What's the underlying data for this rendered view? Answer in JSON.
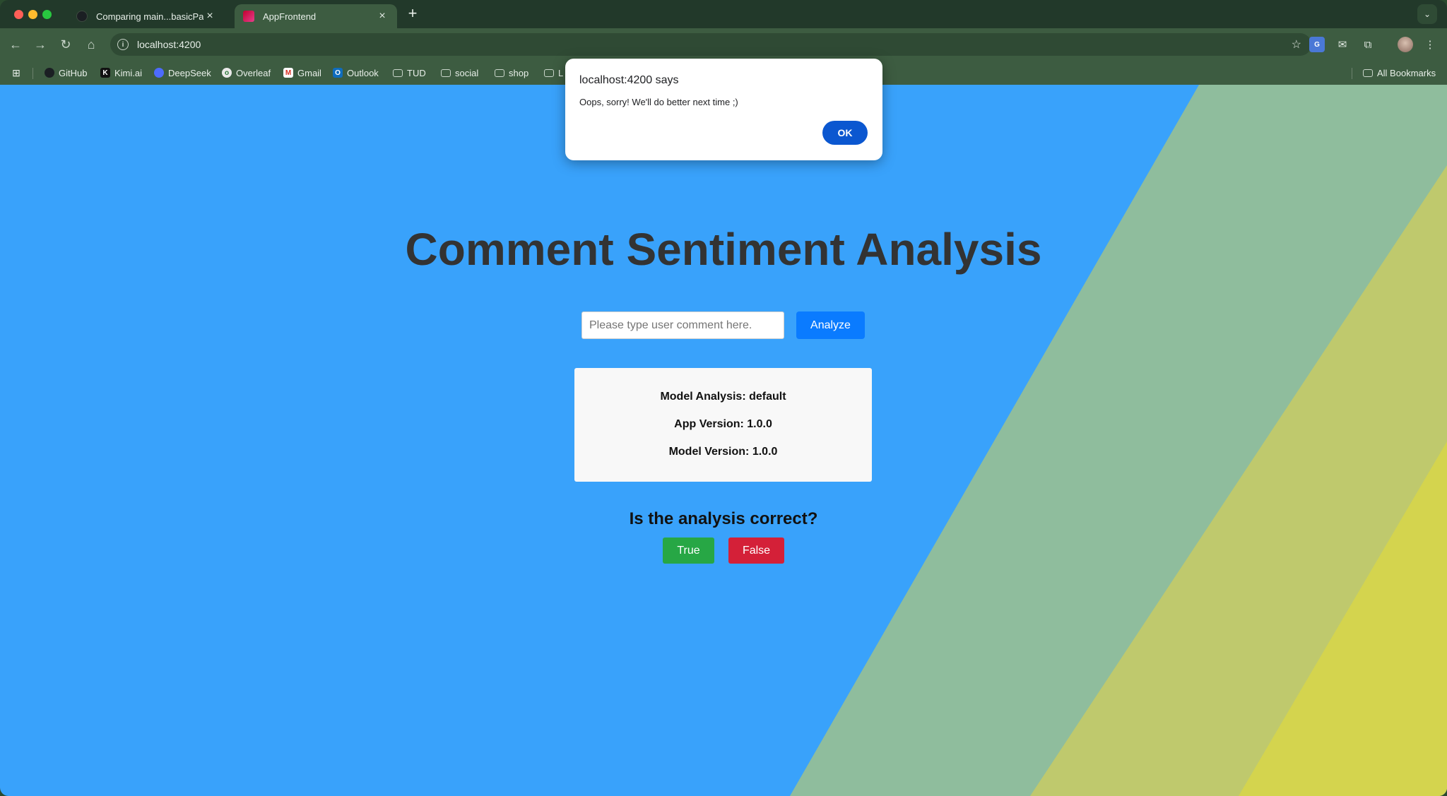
{
  "browser": {
    "tabs": [
      {
        "title": "Comparing main...basicPage",
        "active": false,
        "favicon": "github-icon"
      },
      {
        "title": "AppFrontend",
        "active": true,
        "favicon": "angular-icon"
      }
    ],
    "new_tab_label": "+",
    "address": "localhost:4200",
    "bookmarks": [
      {
        "label": "GitHub",
        "icon": "github-icon"
      },
      {
        "label": "Kimi.ai",
        "icon": "kimi-icon"
      },
      {
        "label": "DeepSeek",
        "icon": "deepseek-icon"
      },
      {
        "label": "Overleaf",
        "icon": "overleaf-icon"
      },
      {
        "label": "Gmail",
        "icon": "gmail-icon"
      },
      {
        "label": "Outlook",
        "icon": "outlook-icon"
      },
      {
        "label": "TUD",
        "icon": "folder-icon"
      },
      {
        "label": "social",
        "icon": "folder-icon"
      },
      {
        "label": "shop",
        "icon": "folder-icon"
      },
      {
        "label": "L",
        "icon": "folder-icon"
      }
    ],
    "all_bookmarks_label": "All Bookmarks"
  },
  "app": {
    "title": "Comment Sentiment Analysis",
    "input_placeholder": "Please type user comment here.",
    "input_value": "",
    "analyze_label": "Analyze",
    "model_analysis": "Model Analysis: default",
    "app_version": "App Version: 1.0.0",
    "model_version": "Model Version: 1.0.0",
    "question": "Is the analysis correct?",
    "true_label": "True",
    "false_label": "False"
  },
  "dialog": {
    "title": "localhost:4200 says",
    "message": "Oops, sorry! We'll do better next time ;)",
    "ok_label": "OK"
  },
  "colors": {
    "page_background": "#39a2fb",
    "analyze_button": "#0a7bff",
    "true_button": "#27a745",
    "false_button": "#d42038",
    "dialog_ok": "#0b57d0"
  }
}
